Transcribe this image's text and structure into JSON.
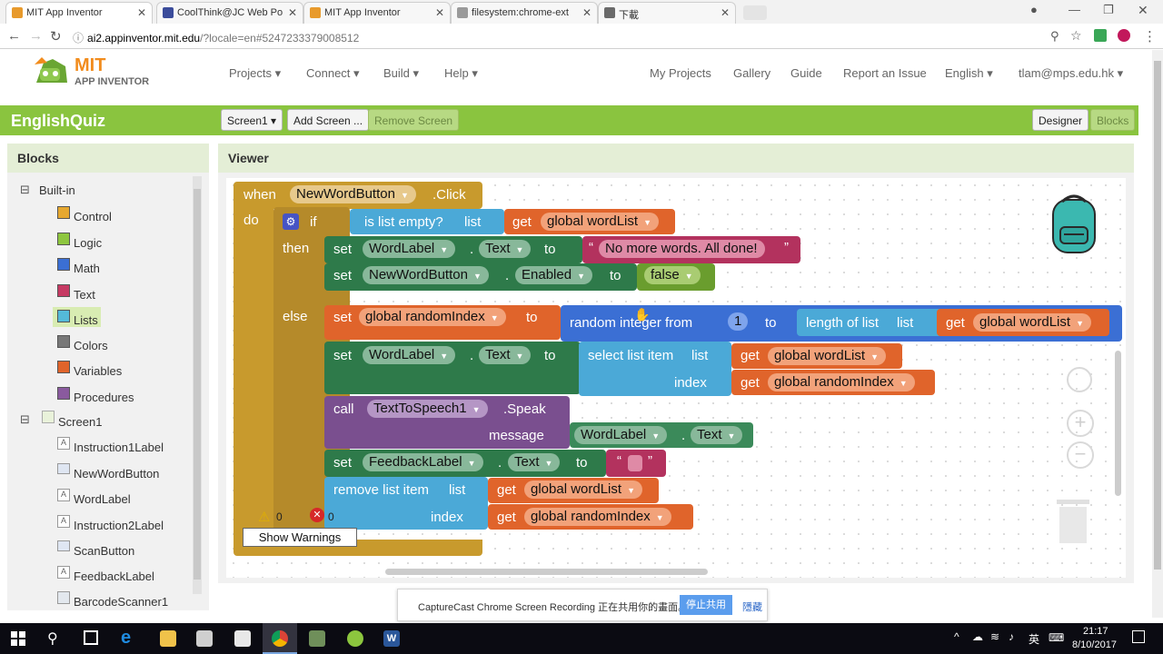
{
  "browser": {
    "tabs": [
      {
        "title": "MIT App Inventor",
        "fav": "#e89a2c"
      },
      {
        "title": "CoolThink@JC Web Po",
        "fav": "#3b4c9b"
      },
      {
        "title": "MIT App Inventor",
        "fav": "#e89a2c"
      },
      {
        "title": "filesystem:chrome-ext",
        "fav": "#9a9a9a"
      },
      {
        "title": "下載",
        "fav": "#6a6a6a"
      }
    ],
    "url_host": "ai2.appinventor.mit.edu",
    "url_rest": "/?locale=en#5247233379008512"
  },
  "app": {
    "logo_line1": "MIT",
    "logo_line2": "APP INVENTOR",
    "menus": [
      "Projects ▾",
      "Connect ▾",
      "Build ▾",
      "Help ▾"
    ],
    "right_links": [
      "My Projects",
      "Gallery",
      "Guide",
      "Report an Issue",
      "English ▾",
      "tlam@mps.edu.hk ▾"
    ],
    "project_name": "EnglishQuiz",
    "screen_select": "Screen1 ▾",
    "add_screen": "Add Screen ...",
    "remove_screen": "Remove Screen",
    "designer": "Designer",
    "blocks_btn": "Blocks"
  },
  "blocks_panel": {
    "title": "Blocks",
    "builtin": "Built-in",
    "categories": [
      {
        "label": "Control",
        "color": "#e6a830"
      },
      {
        "label": "Logic",
        "color": "#8ec63f"
      },
      {
        "label": "Math",
        "color": "#3b6fd4"
      },
      {
        "label": "Text",
        "color": "#c63a63"
      },
      {
        "label": "Lists",
        "color": "#54bad9"
      },
      {
        "label": "Colors",
        "color": "#777777"
      },
      {
        "label": "Variables",
        "color": "#e0642b"
      },
      {
        "label": "Procedures",
        "color": "#8a5a9e"
      }
    ],
    "screen": "Screen1",
    "components": [
      "Instruction1Label",
      "NewWordButton",
      "WordLabel",
      "Instruction2Label",
      "ScanButton",
      "FeedbackLabel",
      "BarcodeScanner1"
    ]
  },
  "viewer": {
    "title": "Viewer",
    "warnings_count": "0",
    "errors_count": "0",
    "show_warnings": "Show Warnings"
  },
  "code": {
    "when": "when",
    "event_component": "NewWordButton",
    "event_name": ".Click",
    "do": "do",
    "if": "if",
    "then": "then",
    "else": "else",
    "is_list_empty": "is list empty?",
    "list": "list",
    "get": "get",
    "global_wordlist": "global wordList",
    "set": "set",
    "to": "to",
    "dot": ".",
    "wordlabel": "WordLabel",
    "text_prop": "Text",
    "no_more_words": "No more words. All done!",
    "newwordbutton": "NewWordButton",
    "enabled": "Enabled",
    "false_val": "false",
    "global_randomindex": "global randomIndex",
    "random_integer_from": "random integer from",
    "one": "1",
    "length_of_list": "length of list",
    "select_list_item": "select list item",
    "index": "index",
    "call": "call",
    "tts": "TextToSpeech1",
    "speak": ".Speak",
    "message": "message",
    "feedbacklabel": "FeedbackLabel",
    "remove_list_item": "remove list item",
    "quote_open": "“",
    "quote_close": "”"
  },
  "notification": {
    "text": "CaptureCast Chrome Screen Recording 正在共用你的畫面。",
    "stop": "停止共用",
    "hide": "隱藏"
  },
  "taskbar": {
    "time": "21:17",
    "date": "8/10/2017",
    "ime": "英"
  }
}
